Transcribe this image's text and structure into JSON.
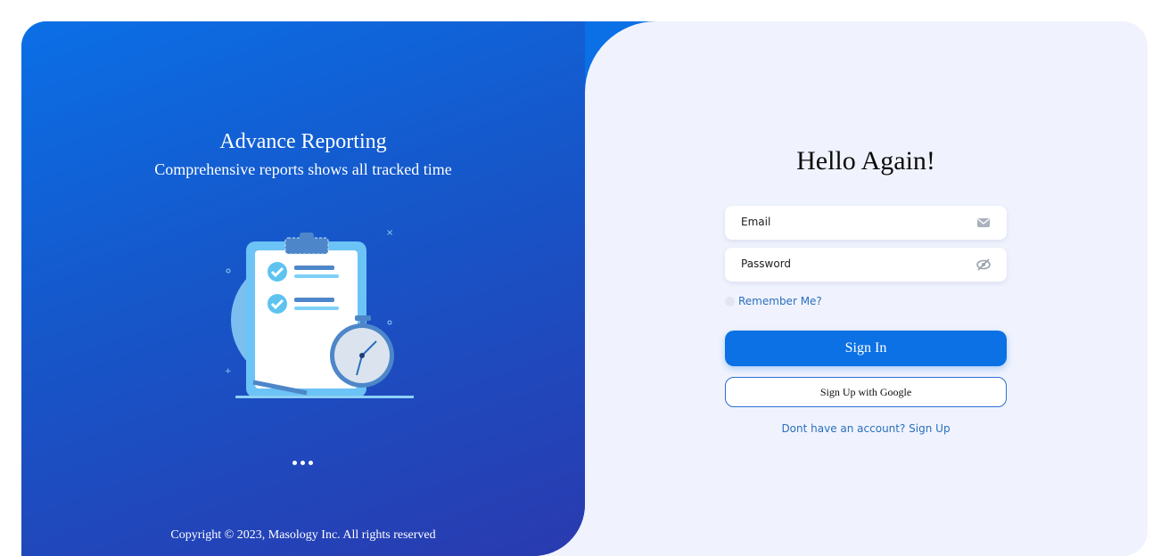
{
  "left_panel": {
    "heading": "Advance Reporting",
    "subheading": "Comprehensive reports shows all tracked time",
    "carousel_dots": 3,
    "copyright": "Copyright © 2023, Masology Inc. All rights reserved",
    "gradient_top": "#0b6fe6",
    "gradient_bottom": "#2a3aaf"
  },
  "login": {
    "title": "Hello Again!",
    "email_label": "Email",
    "email_icon": "mail-icon",
    "password_label": "Password",
    "password_icon": "eye-slash-icon",
    "remember_label": "Remember Me?",
    "sign_in_label": "Sign In",
    "google_label": "Sign Up with Google",
    "signup_prompt": "Dont have an account? Sign Up",
    "accent": "#0b71e4"
  }
}
